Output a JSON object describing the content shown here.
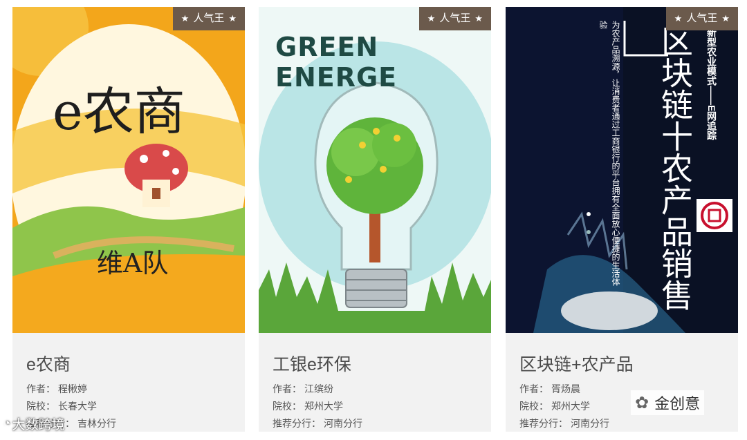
{
  "cards": [
    {
      "badge": "人气王",
      "poster": {
        "main": "e农商",
        "team": "维A队"
      },
      "title": "e农商",
      "meta": [
        {
          "label": "作者：",
          "value": "程楸婷"
        },
        {
          "label": "院校：",
          "value": "长春大学"
        },
        {
          "label": "推荐分行：",
          "value": "吉林分行"
        }
      ]
    },
    {
      "badge": "人气王",
      "poster": {
        "main": "GREEN ENERGE"
      },
      "title": "工银e环保",
      "meta": [
        {
          "label": "作者：",
          "value": "江缤纷"
        },
        {
          "label": "院校：",
          "value": "郑州大学"
        },
        {
          "label": "推荐分行：",
          "value": "河南分行"
        }
      ]
    },
    {
      "badge": "人气王",
      "poster": {
        "big1": "区块链十农产品销售",
        "side1": "新型农业模式——E网追踪",
        "side2": "为农产品溯源，让消费者通过工商银行的平台拥有全面放心便捷的生活体验"
      },
      "title": "区块链+农产品",
      "meta": [
        {
          "label": "作者：",
          "value": "胥炀晨"
        },
        {
          "label": "院校：",
          "value": "郑州大学"
        },
        {
          "label": "推荐分行：",
          "value": "河南分行"
        }
      ]
    }
  ],
  "watermarks": {
    "left": "大数跨境",
    "right": "金创意"
  },
  "colors": {
    "badge": "#6b5a4c",
    "card_bg": "#f2f2f2"
  }
}
